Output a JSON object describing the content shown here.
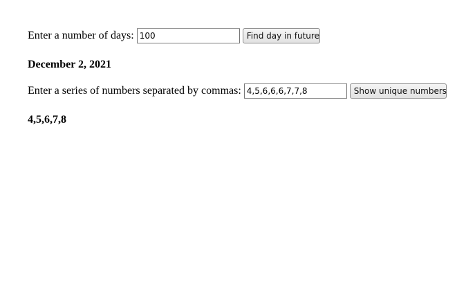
{
  "days_section": {
    "label": "Enter a number of days:",
    "input_value": "100",
    "button_label": "Find day in future",
    "result": "December 2, 2021"
  },
  "unique_section": {
    "label": "Enter a series of numbers separated by commas:",
    "input_value": "4,5,6,6,6,7,7,8",
    "button_label": "Show unique numbers",
    "result": "4,5,6,7,8"
  }
}
